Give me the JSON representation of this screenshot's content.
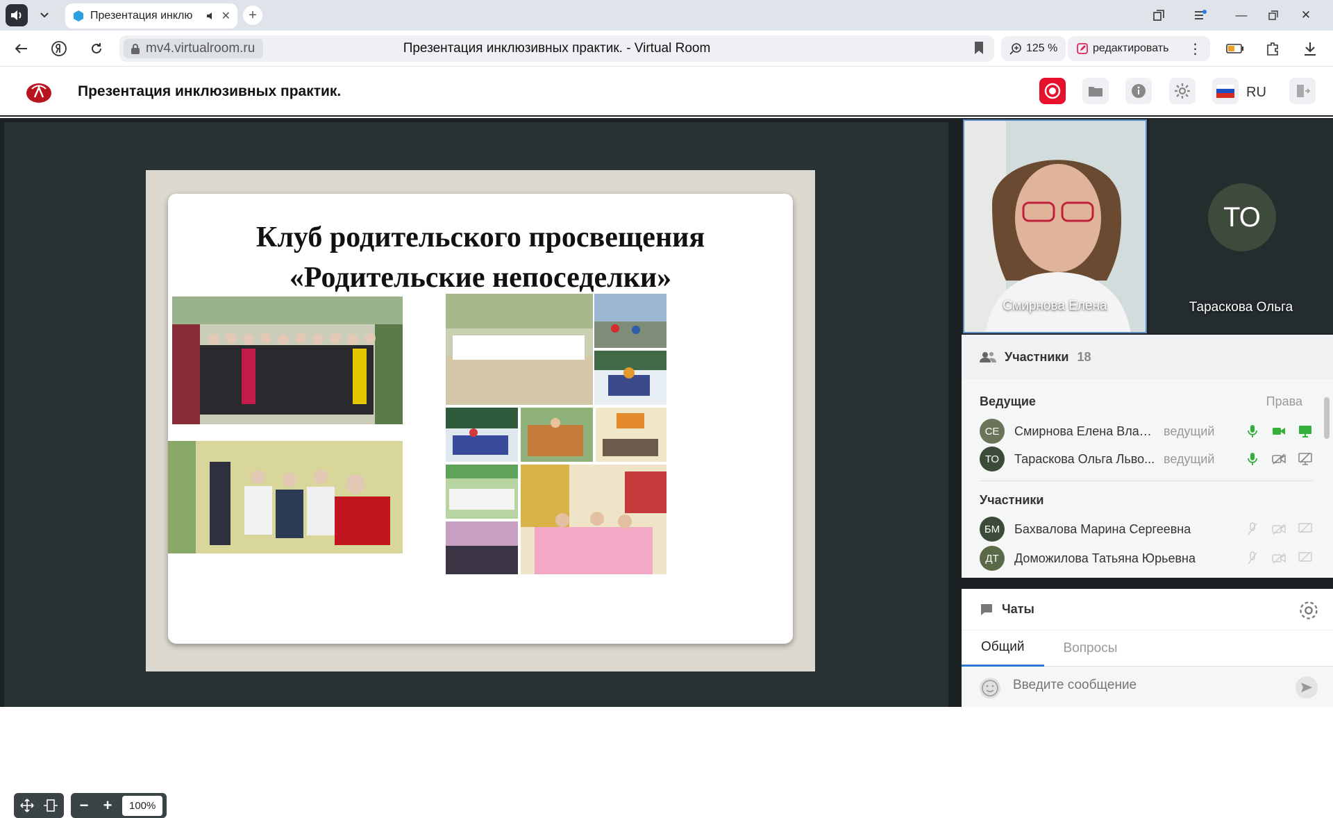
{
  "browser": {
    "tab_title": "Презентация инклю",
    "url": "mv4.virtualroom.ru",
    "page_title": "Презентация инклюзивных практик. - Virtual Room",
    "zoom": "125 %",
    "edit_label": "редактировать"
  },
  "app": {
    "title": "Презентация инклюзивных практик.",
    "language": "RU"
  },
  "slide": {
    "title_line1": "Клуб родительского просвещения",
    "title_line2": "«Родительские непоседелки»"
  },
  "viewer": {
    "zoom_value": "100%"
  },
  "videos": [
    {
      "name": "Смирнова Елена"
    },
    {
      "name": "Тараскова Ольга",
      "initials": "ТО"
    }
  ],
  "participants": {
    "label": "Участники",
    "count": "18",
    "hosts_label": "Ведущие",
    "rights_label": "Права",
    "members_label": "Участники",
    "hosts": [
      {
        "initials": "СЕ",
        "name": "Смирнова Елена Влад...",
        "role": "ведущий"
      },
      {
        "initials": "ТО",
        "name": "Тараскова Ольга Льво...",
        "role": "ведущий"
      }
    ],
    "members": [
      {
        "initials": "БМ",
        "name": "Бахвалова Марина Сергеевна"
      },
      {
        "initials": "ДТ",
        "name": "Доможилова Татьяна Юрьевна"
      }
    ]
  },
  "chat": {
    "label": "Чаты",
    "tabs": [
      "Общий",
      "Вопросы"
    ],
    "placeholder": "Введите сообщение"
  }
}
